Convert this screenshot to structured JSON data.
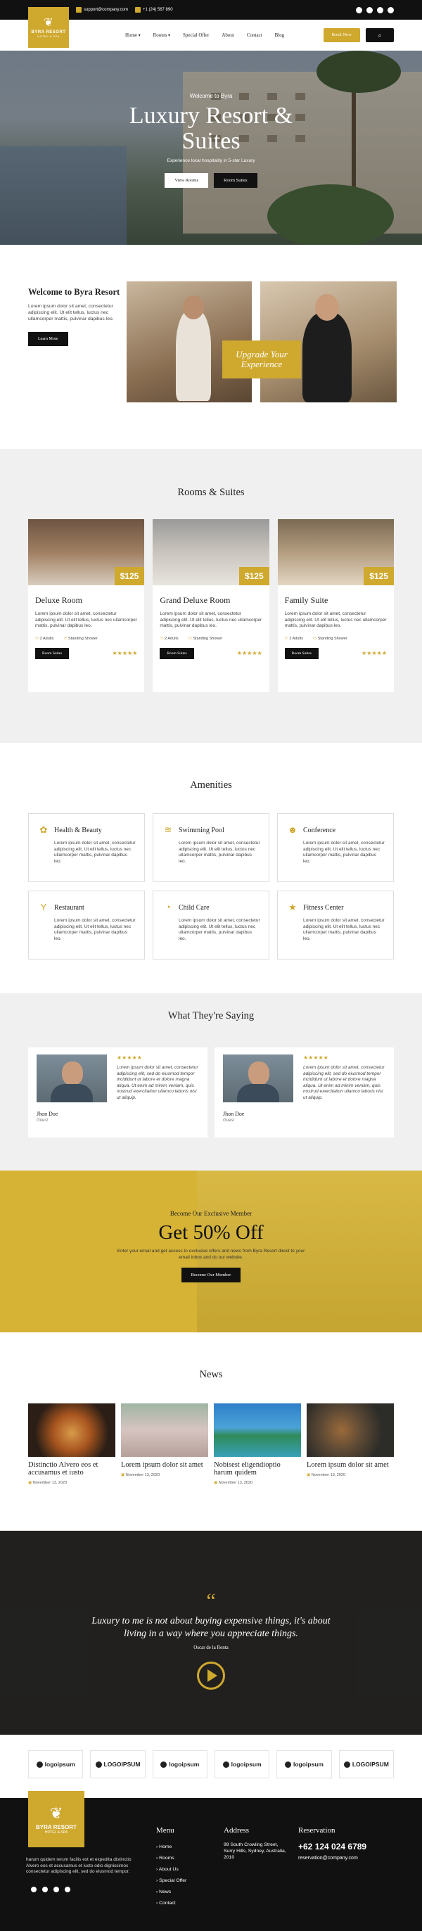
{
  "topbar": {
    "email": "support@company.com",
    "phone": "+1 (24) 567 890",
    "social_icons": [
      "facebook-icon",
      "twitter-icon",
      "instagram-icon",
      "youtube-icon"
    ]
  },
  "header": {
    "logo_title": "BYRA RESORT",
    "logo_subtitle": "HOTEL & SPA",
    "nav": [
      "Home",
      "Rooms",
      "Special Offer",
      "About",
      "Contact",
      "Blog"
    ],
    "book_label": "Book Now",
    "search_icon": "search-icon"
  },
  "hero": {
    "kicker": "Welcome to Byra",
    "title": "Luxury Resort & Suites",
    "subtitle": "Experience local hospitality in 5-star Luxury",
    "btn_primary": "View Rooms",
    "btn_secondary": "Room Suites"
  },
  "welcome": {
    "title": "Welcome to Byra Resort",
    "body": "Lorem ipsum dolor sit amet, consectetur adipiscing elit. Ut elit tellus, luctus nec ullamcorper mattis, pulvinar dapibus leo.",
    "button": "Learn More",
    "badge": "Upgrade Your Experience"
  },
  "rooms": {
    "title": "Rooms & Suites",
    "items": [
      {
        "name": "Deluxe Room",
        "price": "$125",
        "body": "Lorem ipsum dolor sit amet, consectetur adipiscing elit. Ut elit tellus, luctus nec ullamcorper mattis, pulvinar dapibus leo.",
        "adults": "2 Adults",
        "shower": "Standing Shower",
        "button": "Room Suites",
        "stars": "★★★★★"
      },
      {
        "name": "Grand Deluxe Room",
        "price": "$125",
        "body": "Lorem ipsum dolor sit amet, consectetur adipiscing elit. Ut elit tellus, luctus nec ullamcorper mattis, pulvinar dapibus leo.",
        "adults": "2 Adults",
        "shower": "Standing Shower",
        "button": "Room Suites",
        "stars": "★★★★★"
      },
      {
        "name": "Family Suite",
        "price": "$125",
        "body": "Lorem ipsum dolor sit amet, consectetur adipiscing elit. Ut elit tellus, luctus nec ullamcorper mattis, pulvinar dapibus leo.",
        "adults": "2 Adults",
        "shower": "Standing Shower",
        "button": "Room Suites",
        "stars": "★★★★★"
      }
    ]
  },
  "amenities": {
    "title": "Amenities",
    "items": [
      {
        "name": "Health & Beauty",
        "icon": "lotus-icon",
        "body": "Lorem ipsum dolor sit amet, consectetur adipiscing elit. Ut elit tellus, luctus nec ullamcorper mattis, pulvinar dapibus leo."
      },
      {
        "name": "Swimming Pool",
        "icon": "pool-icon",
        "body": "Lorem ipsum dolor sit amet, consectetur adipiscing elit. Ut elit tellus, luctus nec ullamcorper mattis, pulvinar dapibus leo."
      },
      {
        "name": "Conference",
        "icon": "group-icon",
        "body": "Lorem ipsum dolor sit amet, consectetur adipiscing elit. Ut elit tellus, luctus nec ullamcorper mattis, pulvinar dapibus leo."
      },
      {
        "name": "Restaurant",
        "icon": "cocktail-icon",
        "body": "Lorem ipsum dolor sit amet, consectetur adipiscing elit. Ut elit tellus, luctus nec ullamcorper mattis, pulvinar dapibus leo."
      },
      {
        "name": "Child Care",
        "icon": "stroller-icon",
        "body": "Lorem ipsum dolor sit amet, consectetur adipiscing elit. Ut elit tellus, luctus nec ullamcorper mattis, pulvinar dapibus leo."
      },
      {
        "name": "Fitness Center",
        "icon": "running-icon",
        "body": "Lorem ipsum dolor sit amet, consectetur adipiscing elit. Ut elit tellus, luctus nec ullamcorper mattis, pulvinar dapibus leo."
      }
    ]
  },
  "testimonials": {
    "title": "What They're Saying",
    "items": [
      {
        "name": "Jhon Doe",
        "role": "Guest",
        "stars": "★★★★★",
        "quote": "Lorem ipsum dolor sit amet, consectetur adipiscing elit, sed do eiusmod tempor incididunt ut labore et dolore magna aliqua. Ut enim ad minim veniam, quis nostrud exercitation ullamco laboris nisi ut aliquip."
      },
      {
        "name": "Jhon Doe",
        "role": "Guest",
        "stars": "★★★★★",
        "quote": "Lorem ipsum dolor sit amet, consectetur adipiscing elit, sed do eiusmod tempor incididunt ut labore et dolore magna aliqua. Ut enim ad minim veniam, quis nostrud exercitation ullamco laboris nisi ut aliquip."
      }
    ]
  },
  "member": {
    "kicker": "Become Our Exclusive Member",
    "headline": "Get 50% Off",
    "body": "Enter your email and get access to exclusive offers and news from Byra Resort direct to your email inbox and do our website.",
    "button": "Become Our Member"
  },
  "news": {
    "title": "News",
    "items": [
      {
        "title": "Distinctio Alvero eos et accusamus et iusto",
        "date": "November 13, 2020"
      },
      {
        "title": "Lorem ipsum dolor sit amet",
        "date": "November 13, 2020"
      },
      {
        "title": "Nobisest eligendioptio harum quidem",
        "date": "November 13, 2020"
      },
      {
        "title": "Lorem ipsum dolor sit amet",
        "date": "November 13, 2020"
      }
    ]
  },
  "quote": {
    "text": "Luxury to me is not about buying expensive things, it's about living in a way where you appreciate things.",
    "author": "Oscar de la Renta",
    "play_icon": "play-icon"
  },
  "brands": [
    "logoipsum",
    "LOGOIPSUM",
    "logoipsum",
    "logoipsum",
    "logoipsum",
    "LOGOIPSUM"
  ],
  "footer": {
    "logo_title": "BYRA RESORT",
    "logo_subtitle": "HOTEL & SPA",
    "about": "harum quidem rerum facilis est et expedita distinctio Alvero eos et accusamus et iusto odio dignissimos consectetur adipiscing elit, sed do eiusmod tempor.",
    "menu_title": "Menu",
    "menu": [
      "Home",
      "Rooms",
      "About Us",
      "Special Offer",
      "News",
      "Contact"
    ],
    "address_title": "Address",
    "address": "99 South Crowling Street, Surry Hills, Sydney, Australia, 2010",
    "reservation_title": "Reservation",
    "phone": "+62 124 024 6789",
    "email": "reservation@company.com"
  }
}
